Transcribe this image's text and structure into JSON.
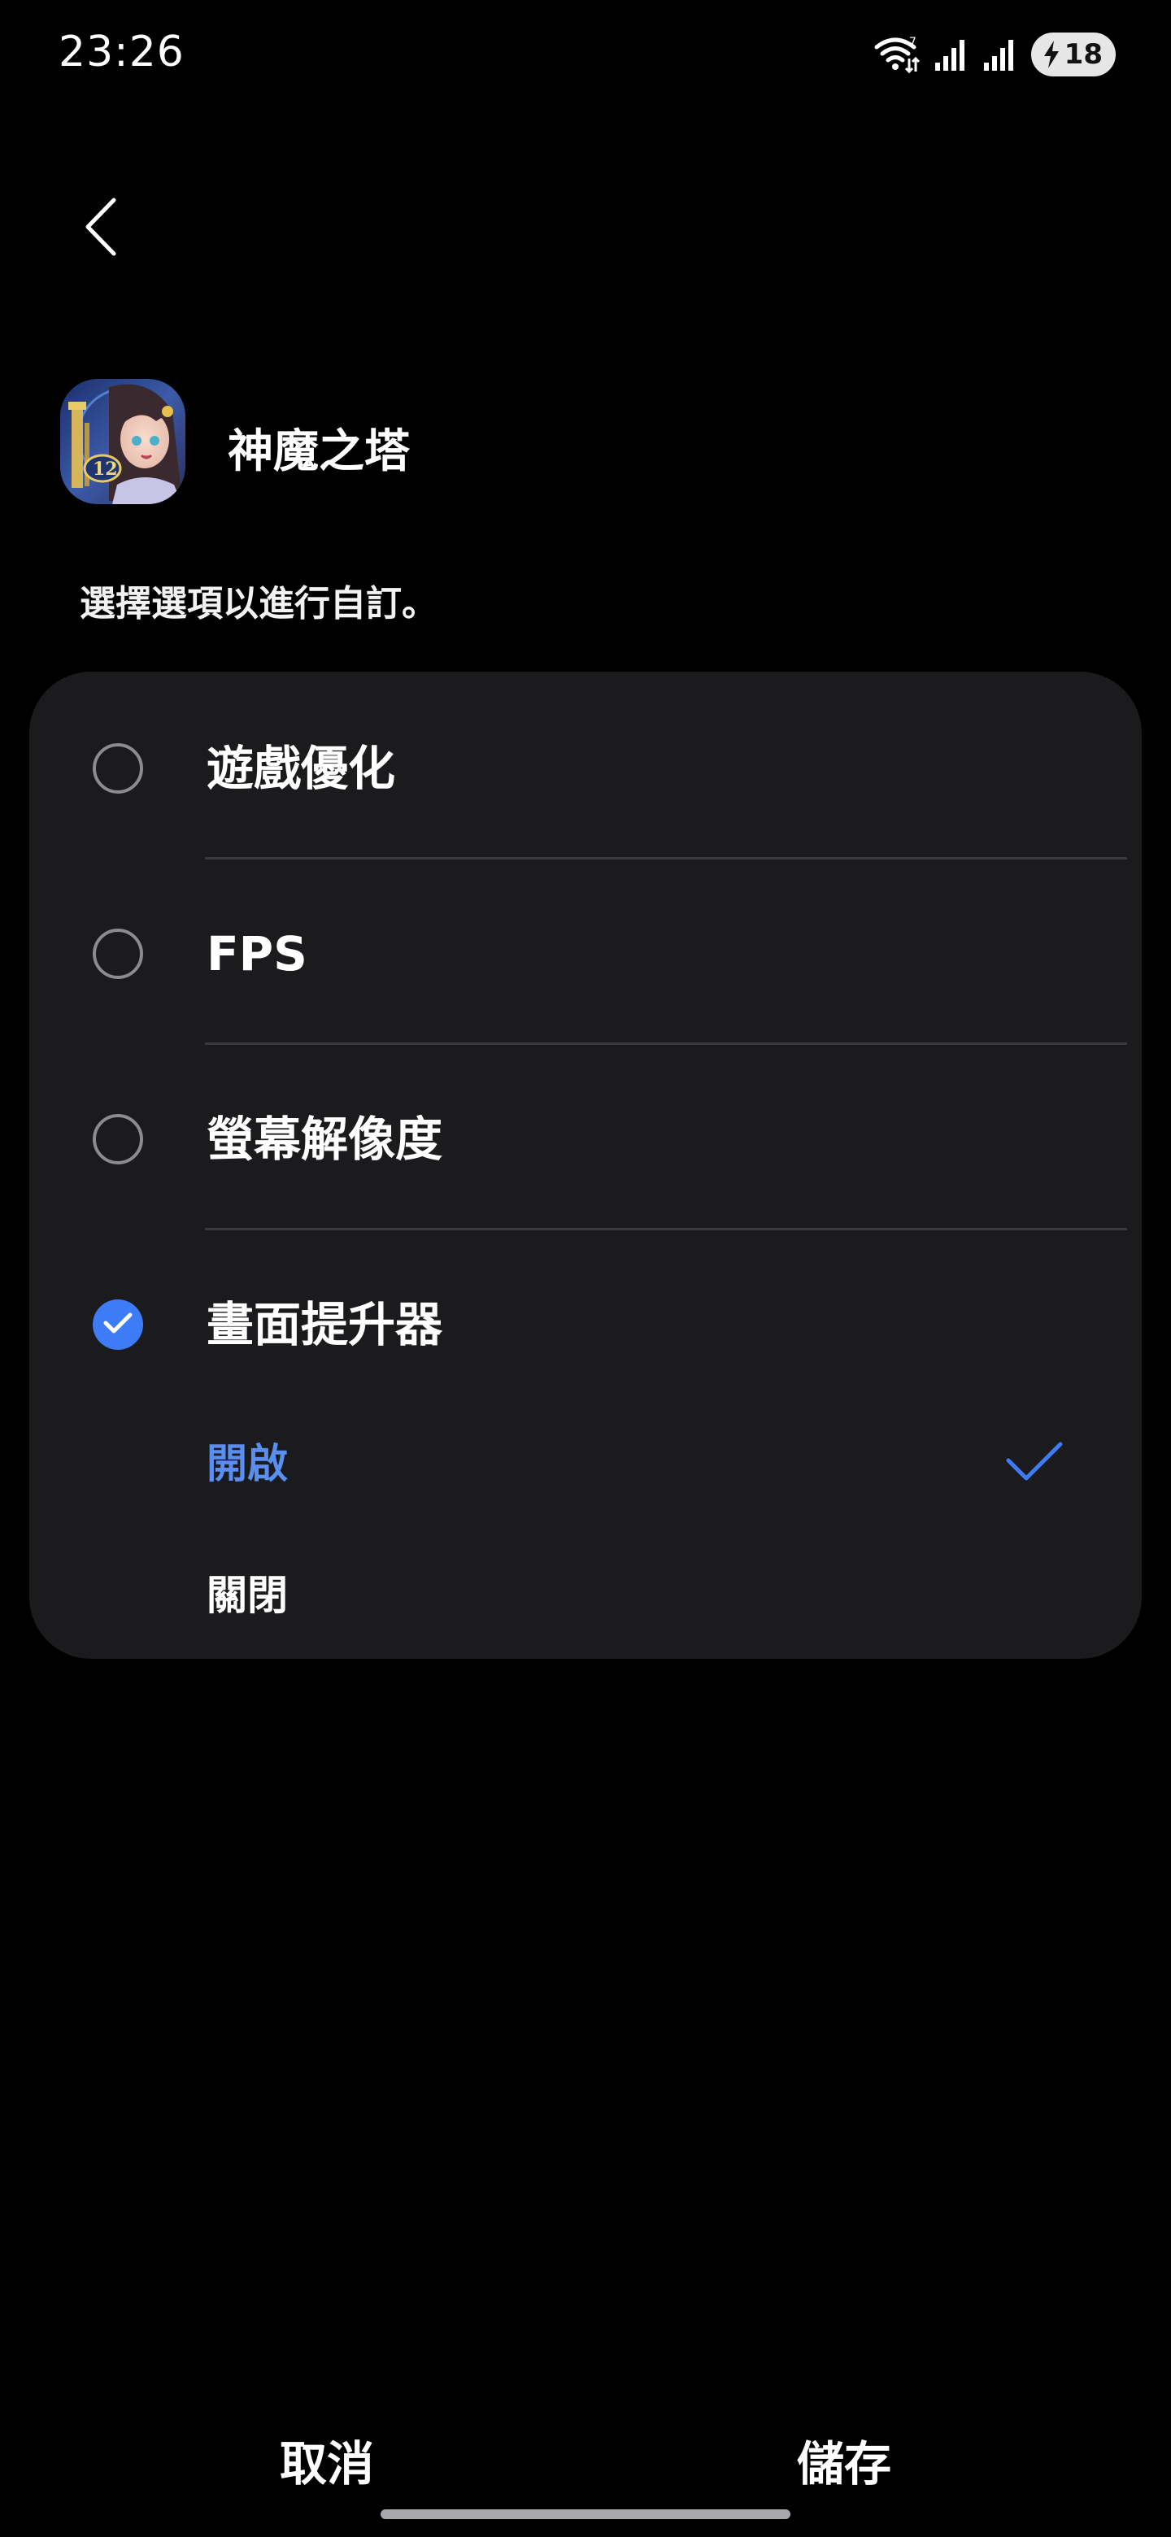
{
  "status_bar": {
    "time": "23:26",
    "icons": [
      "wifi-icon",
      "signal-icon",
      "signal-icon",
      "battery-charging-icon"
    ],
    "battery_level": "18"
  },
  "header": {
    "back_icon": "chevron-left-icon",
    "app_name": "神魔之塔",
    "instruction": "選擇選項以進行自訂。"
  },
  "options": [
    {
      "label": "遊戲優化",
      "checked": false
    },
    {
      "label": "FPS",
      "checked": false
    },
    {
      "label": "螢幕解像度",
      "checked": false
    },
    {
      "label": "畫面提升器",
      "checked": true
    }
  ],
  "sub_options": [
    {
      "label": "開啟",
      "selected": true
    },
    {
      "label": "關閉",
      "selected": false
    }
  ],
  "footer": {
    "cancel_label": "取消",
    "save_label": "儲存"
  },
  "colors": {
    "accent": "#3d7bf7",
    "selected_text": "#5a8ef0",
    "card": "#1b1b1e",
    "background": "#000000"
  }
}
